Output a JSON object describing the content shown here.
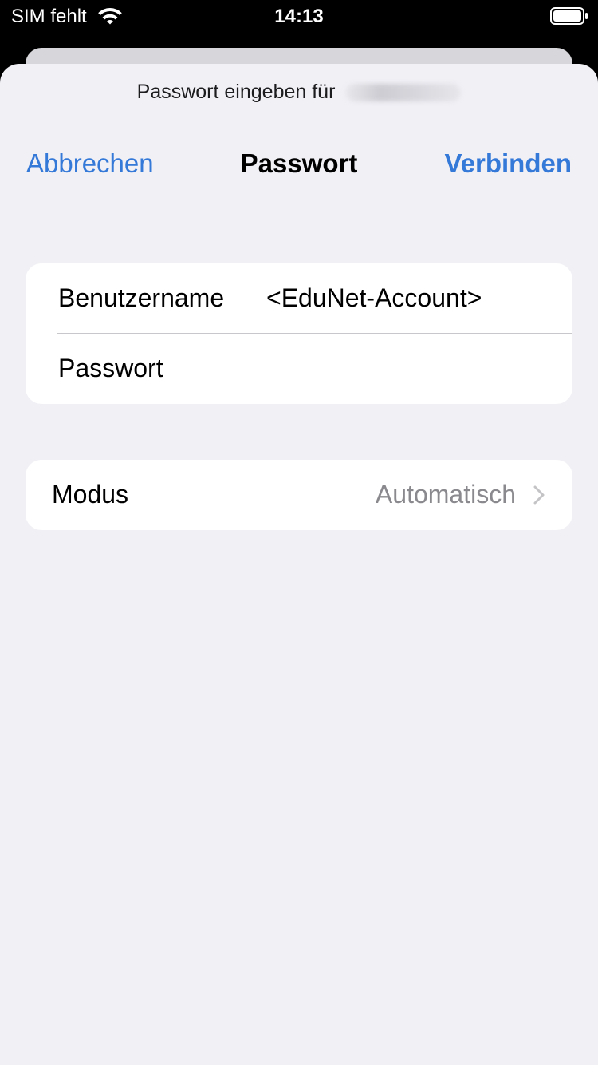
{
  "status_bar": {
    "carrier": "SIM fehlt",
    "time": "14:13",
    "wifi_icon": "wifi-icon",
    "battery_icon": "battery-icon"
  },
  "prompt": {
    "text": "Passwort eingeben für"
  },
  "nav": {
    "cancel_label": "Abbrechen",
    "title": "Passwort",
    "connect_label": "Verbinden"
  },
  "credentials": {
    "username_label": "Benutzername",
    "username_value": "<EduNet-Account>",
    "password_label": "Passwort",
    "password_value": ""
  },
  "mode": {
    "label": "Modus",
    "value": "Automatisch",
    "icon": "chevron-right-icon"
  },
  "colors": {
    "accent": "#3478d8",
    "sheet_background": "#f0f0f5",
    "secondary_text": "#8a8a8e"
  }
}
